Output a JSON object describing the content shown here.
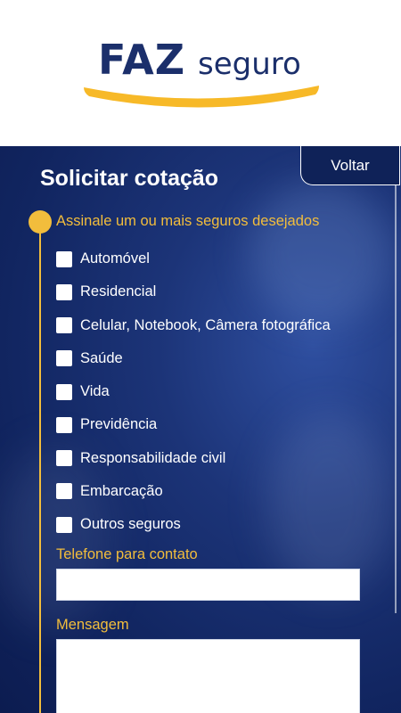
{
  "brand": {
    "logo_main": "FAZ",
    "logo_sub": "seguro"
  },
  "panel": {
    "title": "Solicitar cotação",
    "back_label": "Voltar",
    "insurance_label": "Assinale um ou mais seguros desejados",
    "insurance_options": [
      "Automóvel",
      "Residencial",
      "Celular, Notebook, Câmera fotográfica",
      "Saúde",
      "Vida",
      "Previdência",
      "Responsabilidade civil",
      "Embarcação",
      "Outros seguros"
    ],
    "phone_label": "Telefone para contato",
    "phone_value": "",
    "message_label": "Mensagem",
    "message_value": ""
  },
  "colors": {
    "navy": "#1b2f6b",
    "accent": "#f2bd3c",
    "panel_bg": "#112560"
  }
}
